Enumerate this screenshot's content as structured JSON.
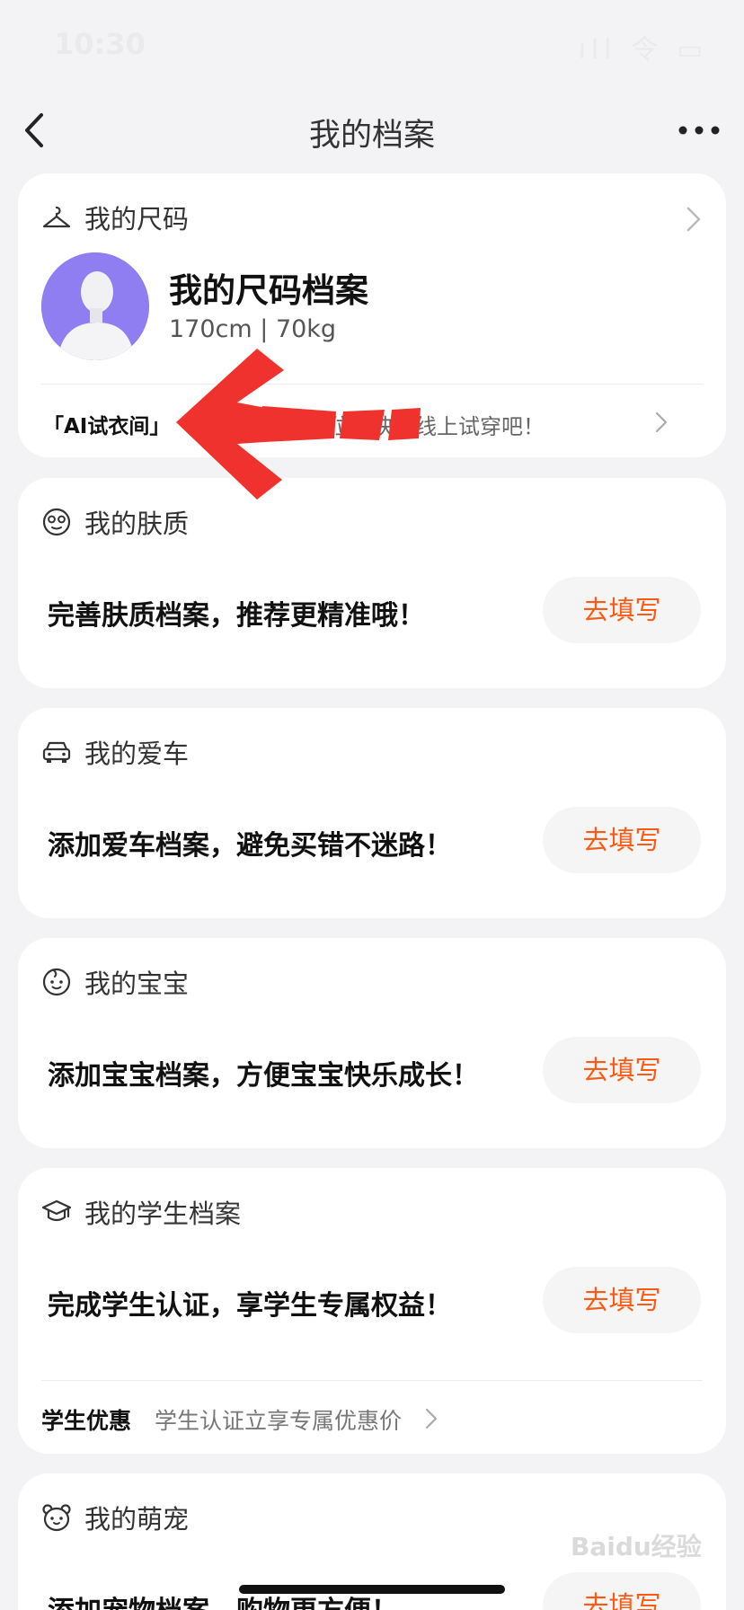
{
  "status_bar": {
    "time": "10:30",
    "indicators": "ıll 令 ▭"
  },
  "nav": {
    "title": "我的档案",
    "back_icon": "chevron-left-icon",
    "more_icon": "more-dots-icon"
  },
  "size_card": {
    "header": "我的尺码",
    "profile_title": "我的尺码档案",
    "profile_sub": "170cm | 70kg",
    "tryon_tag": "「AI试衣间」",
    "tryon_text": "尺码已就位，快来线上试穿吧！"
  },
  "cards": [
    {
      "header": "我的肤质",
      "text": "完善肤质档案，推荐更精准哦！",
      "button": "去填写"
    },
    {
      "header": "我的爱车",
      "text": "添加爱车档案，避免买错不迷路！",
      "button": "去填写"
    },
    {
      "header": "我的宝宝",
      "text": "添加宝宝档案，方便宝宝快乐成长！",
      "button": "去填写"
    },
    {
      "header": "我的学生档案",
      "text": "完成学生认证，享学生专属权益！",
      "button": "去填写"
    },
    {
      "header": "我的萌宠",
      "text": "添加宠物档案，购物更方便！",
      "button": "去填写"
    }
  ],
  "student_promo": {
    "label": "学生优惠",
    "text": "学生认证立享专属优惠价"
  },
  "watermark": "Baidu经验",
  "colors": {
    "accent": "#ff5a14",
    "annotation_arrow": "#f0322e",
    "background": "#f3f3f5"
  }
}
